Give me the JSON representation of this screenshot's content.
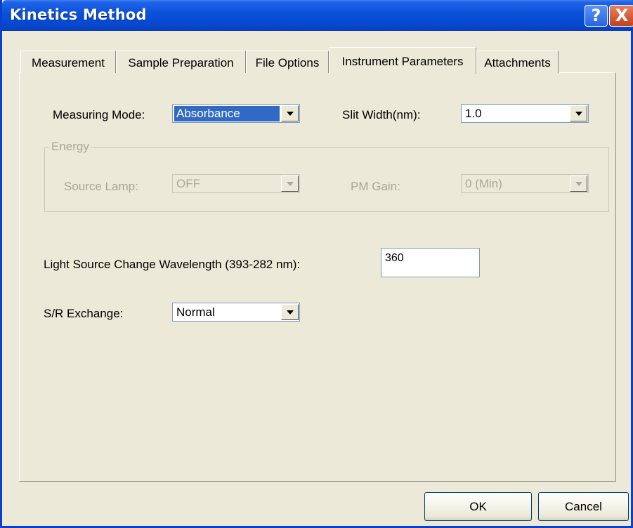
{
  "window": {
    "title": "Kinetics Method"
  },
  "titlebar_buttons": {
    "help": "?",
    "close": "X"
  },
  "tabs": [
    {
      "label": "Measurement",
      "active": false
    },
    {
      "label": "Sample Preparation",
      "active": false
    },
    {
      "label": "File Options",
      "active": false
    },
    {
      "label": "Instrument Parameters",
      "active": true
    },
    {
      "label": "Attachments",
      "active": false
    }
  ],
  "measuring_mode": {
    "label": "Measuring Mode:",
    "value": "Absorbance"
  },
  "slit_width": {
    "label": "Slit Width(nm):",
    "value": "1.0"
  },
  "energy": {
    "title": "Energy",
    "source_lamp": {
      "label": "Source Lamp:",
      "value": "OFF"
    },
    "pm_gain": {
      "label": "PM Gain:",
      "value": "0 (Min)"
    }
  },
  "light_source": {
    "label": "Light Source Change Wavelength (393-282 nm):",
    "value": "360"
  },
  "sr_exchange": {
    "label": "S/R Exchange:",
    "value": "Normal"
  },
  "buttons": {
    "ok": "OK",
    "cancel": "Cancel"
  },
  "colors": {
    "titlebar": "#0a51d8",
    "face": "#ece9d8",
    "selection": "#316ac5"
  }
}
